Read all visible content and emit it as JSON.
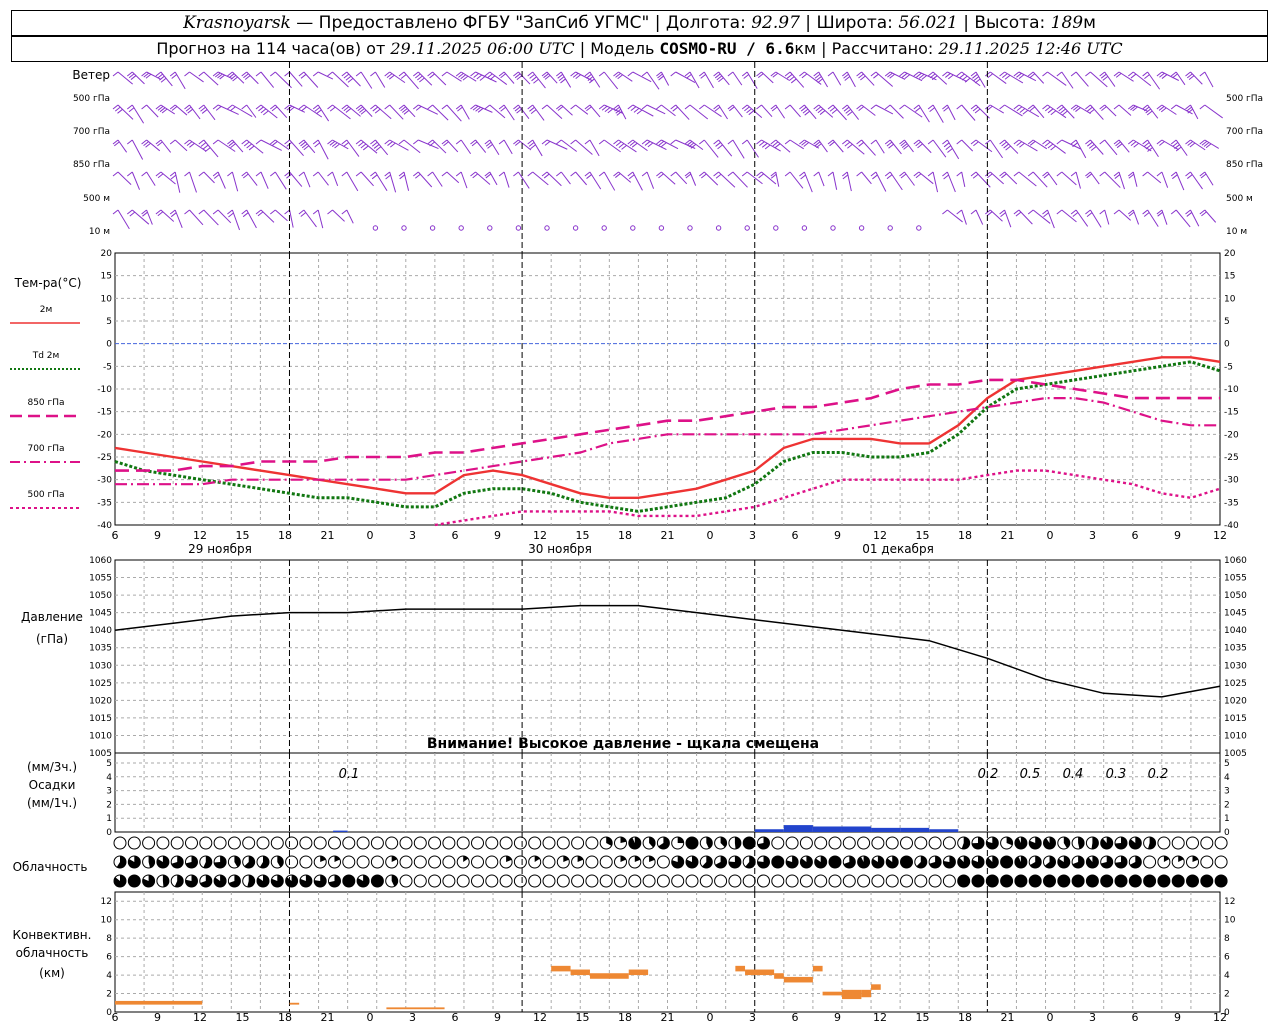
{
  "header": {
    "city": "Krasnoyarsk",
    "provider": " — Предоставлено ФГБУ \"ЗапСиб УГМС\" | Долгота: ",
    "lon": "92.97",
    "lat_label": " | Широта: ",
    "lat": "56.021",
    "alt_label": " | Высота: ",
    "alt": "189",
    "alt_unit": "м",
    "forecast_label": "Прогноз на 114 часа(ов) от ",
    "forecast_start": "29.11.2025 06:00 UTC",
    "model_label": " | Модель ",
    "model": "COSMO-RU / 6.6",
    "model_unit": "км",
    "computed_label": " | Рассчитано: ",
    "computed": "29.11.2025 12:46 UTC"
  },
  "wind": {
    "title": "Ветер",
    "levels": [
      "500 гПа",
      "700 гПа",
      "850 гПа",
      "500 м",
      "10  м"
    ],
    "levels_right": [
      "500 гПа",
      "700 гПа",
      "850 гПа",
      "500 м",
      "10  м"
    ]
  },
  "temperature": {
    "title": "Тем-ра(°C)",
    "legend": [
      {
        "label": "2м",
        "color": "#ee3333"
      },
      {
        "label": "Td 2м",
        "color": "#117711"
      },
      {
        "label": "850 гПа",
        "color": "#dd1188"
      },
      {
        "label": "700 гПа",
        "color": "#dd1188"
      },
      {
        "label": "500 гПа",
        "color": "#dd1188"
      }
    ],
    "yticks": [
      "20",
      "15",
      "10",
      "5",
      "0",
      "-5",
      "-10",
      "-15",
      "-20",
      "-25",
      "-30",
      "-35",
      "-40"
    ],
    "hour_ticks": [
      "6",
      "9",
      "12",
      "15",
      "18",
      "21",
      "0",
      "3",
      "6",
      "9",
      "12",
      "15",
      "18",
      "21",
      "0",
      "3",
      "6",
      "9",
      "12",
      "15",
      "18",
      "21",
      "0",
      "3",
      "6",
      "9",
      "12"
    ],
    "days": [
      "29 ноября",
      "30 ноября",
      "01 декабря"
    ]
  },
  "pressure": {
    "title": "Давление",
    "unit": "(гПа)",
    "yticks": [
      "1060",
      "1055",
      "1050",
      "1045",
      "1040",
      "1035",
      "1030",
      "1025",
      "1020",
      "1015",
      "1010",
      "1005"
    ],
    "warning": "Внимание! Высокое давление - щкала смещена"
  },
  "precip": {
    "unit3": "(мм/3ч.)",
    "title": "Осадки",
    "unit1": "(мм/1ч.)",
    "yticks": [
      "5",
      "4",
      "3",
      "2",
      "1",
      "0"
    ],
    "labels": [
      "0.1",
      "0.2",
      "0.5",
      "0.4",
      "0.3",
      "0.2"
    ]
  },
  "cloud": {
    "title": "Облачность"
  },
  "convective": {
    "title": "Конвективн.",
    "title2": "облачность",
    "unit": "(км)",
    "yticks": [
      "12",
      "10",
      "8",
      "6",
      "4",
      "2",
      "0"
    ],
    "hour_ticks": [
      "6",
      "9",
      "12",
      "15",
      "18",
      "21",
      "0",
      "3",
      "6",
      "9",
      "12",
      "15",
      "18",
      "21",
      "0",
      "3",
      "6",
      "9",
      "12",
      "15",
      "18",
      "21",
      "0",
      "3",
      "6",
      "9",
      "12"
    ]
  },
  "colors": {
    "t2m": "#ee3333",
    "td": "#117711",
    "upper": "#dd1188",
    "wind": "#8833cc",
    "precip": "#2244cc",
    "conv": "#ee8833"
  },
  "chart_data": [
    {
      "type": "line",
      "title": "Тем-ра(°C)",
      "ylim": [
        -40,
        20
      ],
      "x_hours_from_start": [
        0,
        3,
        6,
        9,
        12,
        15,
        18,
        21,
        24,
        27,
        30,
        33,
        36,
        39,
        42,
        45,
        48,
        51,
        54,
        57,
        60,
        63,
        66,
        69,
        72,
        75,
        78,
        81,
        84,
        87,
        90,
        93,
        96,
        99,
        102,
        105,
        108,
        111,
        114
      ],
      "series": [
        {
          "name": "2м",
          "values": [
            -23,
            -24,
            -25,
            -26,
            -27,
            -28,
            -29,
            -30,
            -31,
            -32,
            -33,
            -33,
            -29,
            -28,
            -29,
            -31,
            -33,
            -34,
            -34,
            -33,
            -32,
            -30,
            -28,
            -23,
            -21,
            -21,
            -21,
            -22,
            -22,
            -18,
            -12,
            -8,
            -7,
            -6,
            -5,
            -4,
            -3,
            -3,
            -4
          ]
        },
        {
          "name": "Td 2м",
          "values": [
            -26,
            -28,
            -29,
            -30,
            -31,
            -32,
            -33,
            -34,
            -34,
            -35,
            -36,
            -36,
            -33,
            -32,
            -32,
            -33,
            -35,
            -36,
            -37,
            -36,
            -35,
            -34,
            -31,
            -26,
            -24,
            -24,
            -25,
            -25,
            -24,
            -20,
            -14,
            -10,
            -9,
            -8,
            -7,
            -6,
            -5,
            -4,
            -6
          ]
        },
        {
          "name": "850 гПа",
          "values": [
            -28,
            -28,
            -28,
            -27,
            -27,
            -26,
            -26,
            -26,
            -25,
            -25,
            -25,
            -24,
            -24,
            -23,
            -22,
            -21,
            -20,
            -19,
            -18,
            -17,
            -17,
            -16,
            -15,
            -14,
            -14,
            -13,
            -12,
            -10,
            -9,
            -9,
            -8,
            -8,
            -9,
            -10,
            -11,
            -12,
            -12,
            -12,
            -12
          ]
        },
        {
          "name": "700 гПа",
          "values": [
            -31,
            -31,
            -31,
            -31,
            -30,
            -30,
            -30,
            -30,
            -30,
            -30,
            -30,
            -29,
            -28,
            -27,
            -26,
            -25,
            -24,
            -22,
            -21,
            -20,
            -20,
            -20,
            -20,
            -20,
            -20,
            -19,
            -18,
            -17,
            -16,
            -15,
            -14,
            -13,
            -12,
            -12,
            -13,
            -15,
            -17,
            -18,
            -18
          ]
        },
        {
          "name": "500 гПа",
          "values": [
            null,
            null,
            null,
            null,
            null,
            null,
            null,
            null,
            null,
            null,
            null,
            -40,
            -39,
            -38,
            -37,
            -37,
            -37,
            -37,
            -38,
            -38,
            -38,
            -37,
            -36,
            -34,
            -32,
            -30,
            -30,
            -30,
            -30,
            -30,
            -29,
            -28,
            -28,
            -29,
            -30,
            -31,
            -33,
            -34,
            -32
          ]
        }
      ]
    },
    {
      "type": "line",
      "title": "Давление",
      "ylim": [
        1005,
        1060
      ],
      "x_hours_from_start": [
        0,
        6,
        12,
        18,
        24,
        30,
        36,
        42,
        48,
        54,
        60,
        66,
        72,
        78,
        84,
        90,
        96,
        102,
        108,
        114
      ],
      "values": [
        1040,
        1042,
        1044,
        1045,
        1045,
        1046,
        1046,
        1046,
        1047,
        1047,
        1045,
        1043,
        1041,
        1039,
        1037,
        1032,
        1026,
        1022,
        1021,
        1024
      ]
    },
    {
      "type": "bar",
      "title": "Осадки",
      "ylim": [
        0,
        5
      ],
      "x_hours_from_start": [
        66,
        69,
        72,
        75,
        78,
        81,
        84
      ],
      "values": [
        0.2,
        0.5,
        0.4,
        0.4,
        0.3,
        0.3,
        0.2
      ],
      "annotations": [
        "0.1",
        "0.2",
        "0.5",
        "0.4",
        "0.3",
        "0.2"
      ]
    },
    {
      "type": "bar",
      "title": "Конвективн. облачность",
      "ylim": [
        0,
        13
      ],
      "segments": [
        {
          "start": 0,
          "end": 9,
          "base": 0.8,
          "top": 1.2
        },
        {
          "start": 18,
          "end": 19,
          "base": 0.8,
          "top": 1.0
        },
        {
          "start": 28,
          "end": 34,
          "base": 0.3,
          "top": 0.5
        },
        {
          "start": 45,
          "end": 47,
          "base": 4.4,
          "top": 5.0
        },
        {
          "start": 47,
          "end": 49,
          "base": 4.0,
          "top": 4.6
        },
        {
          "start": 49,
          "end": 53,
          "base": 3.6,
          "top": 4.2
        },
        {
          "start": 53,
          "end": 55,
          "base": 4.0,
          "top": 4.6
        },
        {
          "start": 64,
          "end": 65,
          "base": 4.4,
          "top": 5.0
        },
        {
          "start": 65,
          "end": 68,
          "base": 4.0,
          "top": 4.6
        },
        {
          "start": 68,
          "end": 69,
          "base": 3.6,
          "top": 4.2
        },
        {
          "start": 69,
          "end": 72,
          "base": 3.2,
          "top": 3.8
        },
        {
          "start": 72,
          "end": 73,
          "base": 4.4,
          "top": 5.0
        },
        {
          "start": 73,
          "end": 75,
          "base": 1.8,
          "top": 2.2
        },
        {
          "start": 75,
          "end": 77,
          "base": 1.4,
          "top": 2.4
        },
        {
          "start": 77,
          "end": 78,
          "base": 1.6,
          "top": 2.4
        },
        {
          "start": 78,
          "end": 79,
          "base": 2.4,
          "top": 3.0
        }
      ]
    }
  ]
}
